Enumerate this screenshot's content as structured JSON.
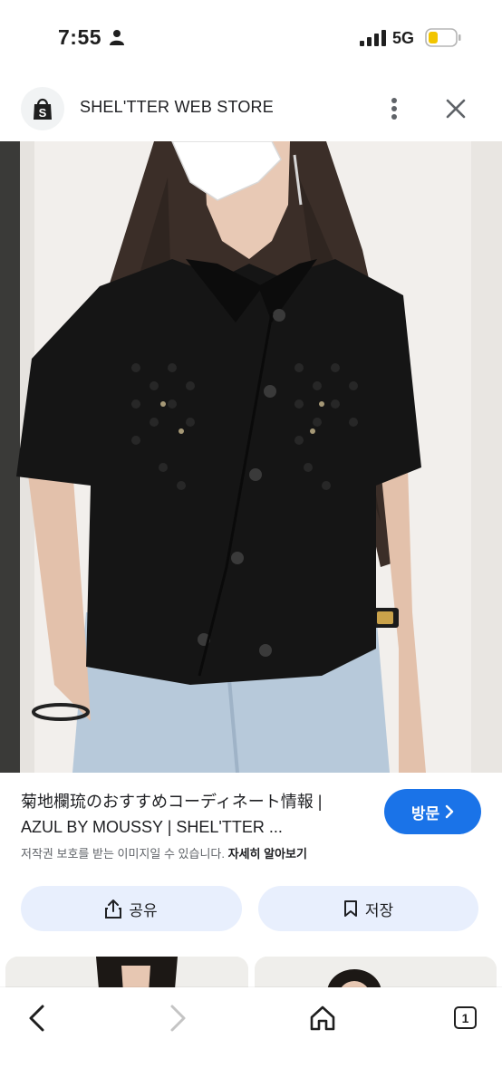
{
  "status_bar": {
    "time": "7:55",
    "network": "5G",
    "icons": [
      "person-icon",
      "signal-icon",
      "battery-icon"
    ]
  },
  "header": {
    "site_name": "SHEL'TTER WEB STORE",
    "logo_letter": "S",
    "icons": [
      "shopping-bag-icon",
      "more-vert-icon",
      "close-icon"
    ]
  },
  "result": {
    "title_line1": "菊地欄琉のおすすめコーディネート情報 |",
    "title_line2": "AZUL BY MOUSSY | SHEL'TTER ...",
    "copyright_text": "저작권 보호를 받는 이미지일 수 있습니다.",
    "learn_more": "자세히 알아보기",
    "visit_label": "방문"
  },
  "actions": {
    "share_label": "공유",
    "save_label": "저장"
  },
  "bottom_nav": {
    "tab_count": "1",
    "icons": [
      "back-icon",
      "forward-icon",
      "home-icon",
      "tabs-icon"
    ]
  },
  "colors": {
    "accent": "#1a73e8",
    "action_bg": "#e8effd",
    "text": "#202124",
    "muted": "#5f6368"
  }
}
